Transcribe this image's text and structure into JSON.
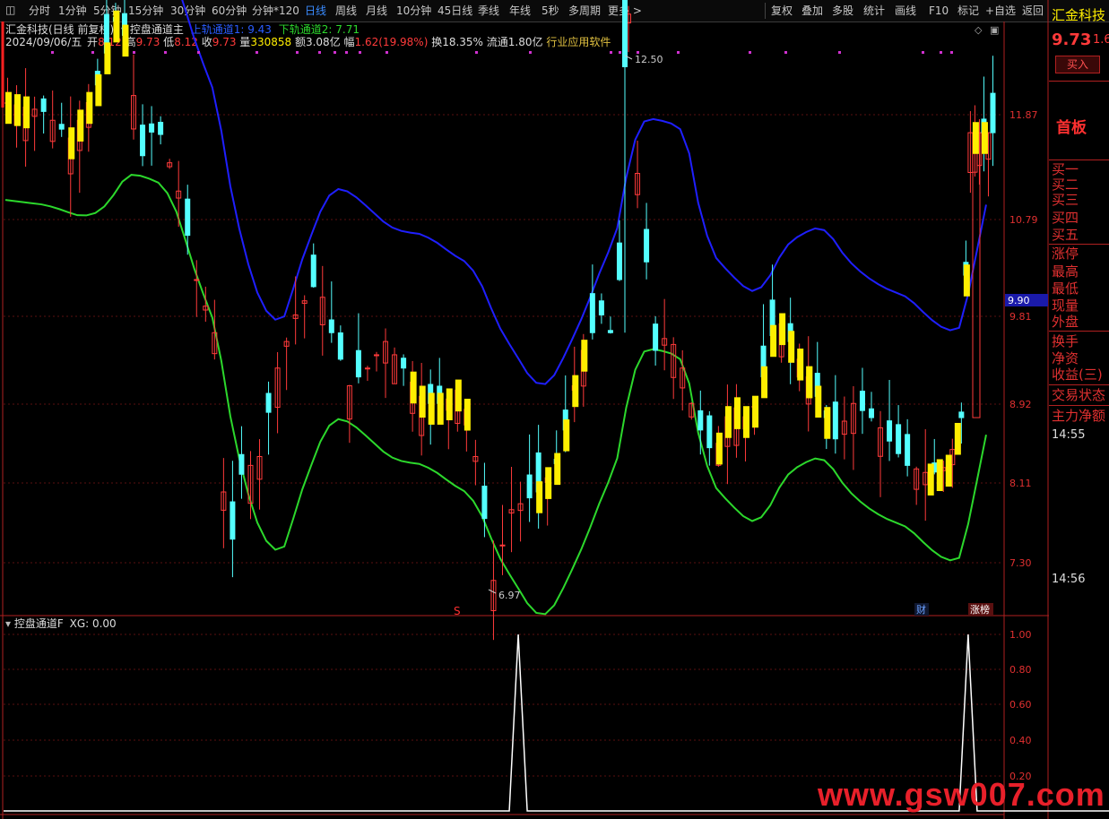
{
  "toolbar": {
    "items": [
      "分时",
      "1分钟",
      "5分钟",
      "15分钟",
      "30分钟",
      "60分钟",
      "分钟*120",
      "日线",
      "周线",
      "月线",
      "10分钟",
      "45日线",
      "季线",
      "年线",
      "5秒",
      "多周期",
      "更多 >"
    ],
    "active": "日线",
    "right_items": [
      "复权",
      "叠加",
      "多股",
      "统计",
      "画线",
      "F10",
      "标记",
      "+自选",
      "返回"
    ]
  },
  "main": {
    "title": "汇金科技(日线 前复权)",
    "indicator_name": "控盘通道主",
    "upper_label": "上轨通道1: 9.43",
    "lower_label": "下轨通道2: 7.71",
    "date": "2024/09/06/五",
    "open_label": "开",
    "open": "8.12",
    "high_label": "高",
    "high": "9.73",
    "low_label": "低",
    "low": "8.12",
    "close_label": "收",
    "close": "9.73",
    "vol_label": "量",
    "vol": "330858",
    "amount": "额3.08亿",
    "amp_label": "幅",
    "amp": "1.62(19.98%)",
    "turnover": "换18.35%",
    "float": "流通1.80亿",
    "industry": "行业应用软件",
    "high_annot": "12.50",
    "low_annot": "6.97",
    "price_marker": "9.90",
    "axis": [
      "11.87",
      "10.79",
      "9.81",
      "8.92",
      "8.11",
      "7.30"
    ],
    "badge_cai": "财",
    "badge_zb": "涨榜",
    "s_marker": "S"
  },
  "sub": {
    "title": "控盘通道F",
    "xg": "XG: 0.00",
    "axis": [
      "1.00",
      "0.80",
      "0.60",
      "0.40",
      "0.20"
    ],
    "peaks_at": [
      57,
      107,
      154,
      203
    ]
  },
  "right_panel": {
    "stock_name": "汇金科技",
    "price": "9.73",
    "change": "1.6",
    "buy": "买入",
    "tag": "首板",
    "bids": [
      "买一",
      "买二",
      "买三",
      "买四",
      "买五"
    ],
    "stats": [
      "涨停",
      "最高",
      "最低",
      "现量",
      "外盘"
    ],
    "stats2": [
      "换手",
      "净资",
      "收益(三)"
    ],
    "state": "交易状态",
    "main_net": "主力净额",
    "times": [
      "14:55",
      "14:56"
    ]
  },
  "watermark": "www.gsw007.com",
  "colors": {
    "up": "#ff3a3a",
    "down": "#54ffff",
    "upper": "#1f1fff",
    "lower": "#2cd82c",
    "yellow": "#ffee00",
    "axis": "#e03030"
  }
}
